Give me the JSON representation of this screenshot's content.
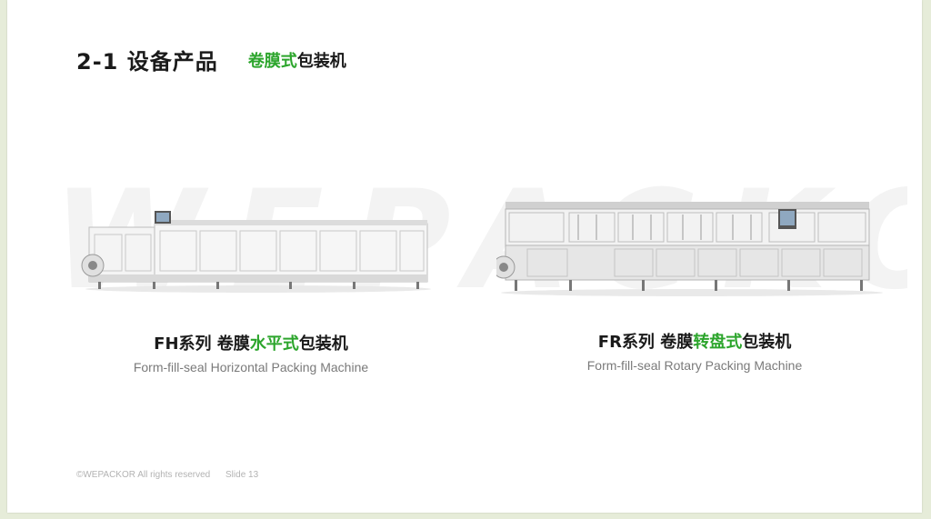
{
  "title": {
    "main": "2-1 设备产品",
    "sub_highlight": "卷膜式",
    "sub_rest": "包装机"
  },
  "watermark": "WEPACKOR",
  "products": [
    {
      "cn_prefix": "FH系列 卷膜",
      "cn_highlight": "水平式",
      "cn_suffix": "包装机",
      "en": "Form-fill-seal Horizontal Packing Machine"
    },
    {
      "cn_prefix": "FR系列 卷膜",
      "cn_highlight": "转盘式",
      "cn_suffix": "包装机",
      "en": "Form-fill-seal Rotary Packing Machine"
    }
  ],
  "footer": {
    "copyright": "©WEPACKOR All rights reserved",
    "slide": "Slide 13"
  },
  "colors": {
    "highlight": "#2ca52c",
    "background": "#e6ecd9"
  }
}
